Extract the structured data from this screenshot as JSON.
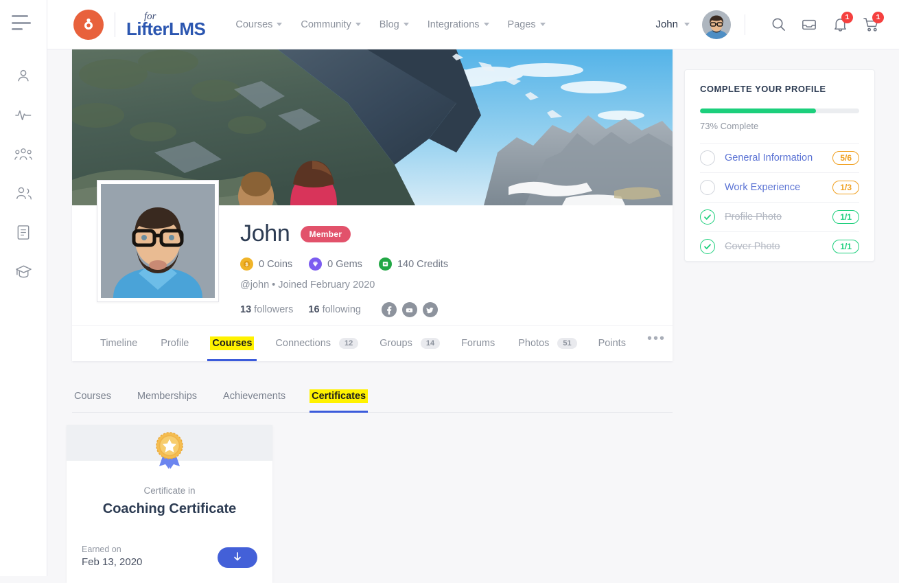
{
  "rail": {
    "toggle_icon": "hamburger-icon",
    "items": [
      {
        "name": "profile",
        "icon": "user-icon"
      },
      {
        "name": "activity",
        "icon": "activity-pulse-icon"
      },
      {
        "name": "groups",
        "icon": "groups-icon"
      },
      {
        "name": "friends",
        "icon": "friends-icon"
      },
      {
        "name": "forums",
        "icon": "document-icon"
      },
      {
        "name": "courses",
        "icon": "graduation-cap-icon"
      }
    ]
  },
  "header": {
    "brand": {
      "for": "for",
      "name_light": "Lifter",
      "name_bold": "LMS",
      "mark_icon": "buddyboss-logo-icon"
    },
    "nav": [
      {
        "label": "Courses",
        "has_caret": true
      },
      {
        "label": "Community",
        "has_caret": true
      },
      {
        "label": "Blog",
        "has_caret": true
      },
      {
        "label": "Integrations",
        "has_caret": true
      },
      {
        "label": "Pages",
        "has_caret": true
      }
    ],
    "user": {
      "name": "John",
      "avatar_icon": "user-avatar"
    },
    "actions": [
      {
        "name": "search",
        "icon": "search-icon",
        "badge": ""
      },
      {
        "name": "messages",
        "icon": "envelope-icon",
        "badge": ""
      },
      {
        "name": "notifications",
        "icon": "bell-icon",
        "badge": "1"
      },
      {
        "name": "cart",
        "icon": "cart-icon",
        "badge": "1"
      }
    ]
  },
  "profile": {
    "cover_alt": "mountain-landscape-cover-photo",
    "avatar_alt": "bearded-man-with-glasses-avatar",
    "display_name": "John",
    "member_badge": "Member",
    "stats": [
      {
        "value": "0 Coins",
        "icon": "coin-icon",
        "color": "#f0b429"
      },
      {
        "value": "0 Gems",
        "icon": "gem-icon",
        "color": "#7b5cf0"
      },
      {
        "value": "140 Credits",
        "icon": "credit-icon",
        "color": "#22a745"
      }
    ],
    "meta": "@john • Joined February 2020",
    "followers_count": "13",
    "followers_label": "followers",
    "following_count": "16",
    "following_label": "following",
    "social": [
      {
        "name": "facebook",
        "icon": "facebook-icon"
      },
      {
        "name": "youtube",
        "icon": "youtube-icon"
      },
      {
        "name": "twitter",
        "icon": "twitter-icon"
      }
    ]
  },
  "primary_tabs": [
    {
      "label": "Timeline",
      "count": "",
      "active": false
    },
    {
      "label": "Profile",
      "count": "",
      "active": false
    },
    {
      "label": "Courses",
      "count": "",
      "active": true
    },
    {
      "label": "Connections",
      "count": "12",
      "active": false
    },
    {
      "label": "Groups",
      "count": "14",
      "active": false
    },
    {
      "label": "Forums",
      "count": "",
      "active": false
    },
    {
      "label": "Photos",
      "count": "51",
      "active": false
    },
    {
      "label": "Points",
      "count": "",
      "active": false
    },
    {
      "label": "•••",
      "count": "",
      "active": false,
      "is_more": true
    }
  ],
  "sub_tabs": [
    {
      "label": "Courses",
      "active": false
    },
    {
      "label": "Memberships",
      "active": false
    },
    {
      "label": "Achievements",
      "active": false
    },
    {
      "label": "Certificates",
      "active": true
    }
  ],
  "certificates": [
    {
      "medal_icon": "award-medal-icon",
      "kicker": "Certificate in",
      "title": "Coaching Certificate",
      "earned_label": "Earned on",
      "earned_date": "Feb 13, 2020",
      "download_icon": "download-arrow-icon"
    }
  ],
  "right_panel": {
    "title": "COMPLETE YOUR PROFILE",
    "progress_percent": 73,
    "progress_label": "73% Complete",
    "progress_color": "#1ccf7c",
    "items": [
      {
        "label": "General Information",
        "badge": "5/6",
        "done": false
      },
      {
        "label": "Work Experience",
        "badge": "1/3",
        "done": false
      },
      {
        "label": "Profile Photo",
        "badge": "1/1",
        "done": true
      },
      {
        "label": "Cover Photo",
        "badge": "1/1",
        "done": true
      }
    ]
  }
}
